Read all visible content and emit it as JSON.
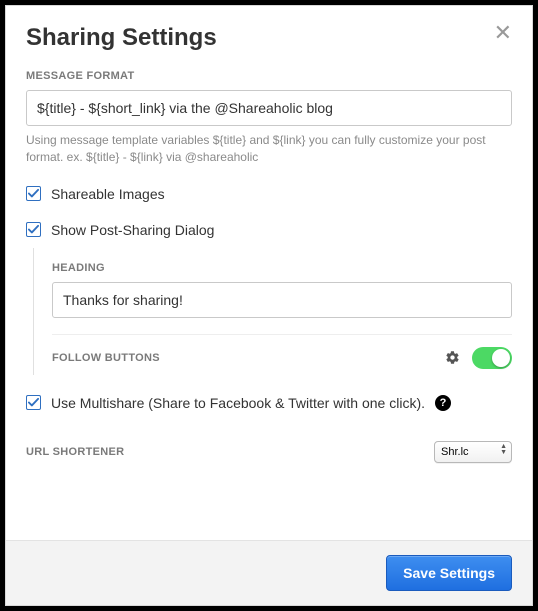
{
  "dialog": {
    "title": "Sharing Settings"
  },
  "message_format": {
    "label": "MESSAGE FORMAT",
    "value": "${title} - ${short_link} via the @Shareaholic blog",
    "hint": "Using message template variables ${title} and ${link} you can fully customize your post format. ex. ${title} - ${link} via @shareaholic"
  },
  "shareable_images": {
    "label": "Shareable Images",
    "checked": true
  },
  "post_sharing": {
    "label": "Show Post-Sharing Dialog",
    "checked": true,
    "heading_label": "HEADING",
    "heading_value": "Thanks for sharing!",
    "follow_buttons_label": "FOLLOW BUTTONS",
    "follow_buttons_on": true
  },
  "multishare": {
    "label": "Use Multishare (Share to Facebook & Twitter with one click).",
    "checked": true,
    "help": "?"
  },
  "url_shortener": {
    "label": "URL SHORTENER",
    "selected": "Shr.lc"
  },
  "footer": {
    "save_label": "Save Settings"
  }
}
